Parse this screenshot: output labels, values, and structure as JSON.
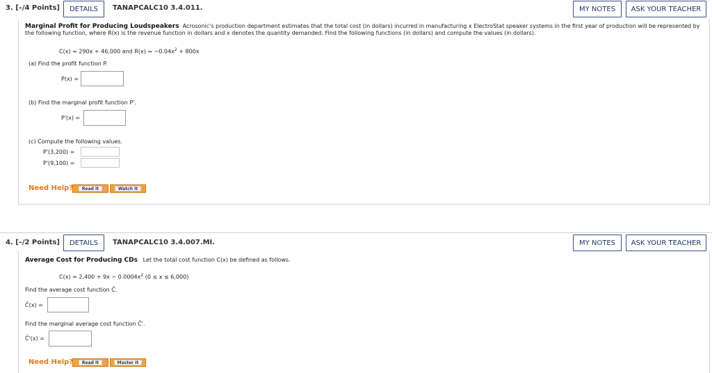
{
  "q1": {
    "number": "3.",
    "points": "[–/4 Points]",
    "details": "DETAILS",
    "code": "TANAPCALC10 3.4.011.",
    "my_notes": "MY NOTES",
    "ask_teacher": "ASK YOUR TEACHER",
    "title": "Marginal Profit for Producing Loudspeakers",
    "intro": "Acrosonic's production department estimates that the total cost (in dollars) incurred in manufacturing x ElectroStat speaker systems in the first year of production will be represented by the following function, where R(x) is the revenue function in dollars and x denotes the quantity demanded. Find the following functions (in dollars) and compute the values (in dollars).",
    "equation": "C(x) = 290x + 46,000   and   R(x) = −0.04x",
    "equation_exp": "2",
    "equation_tail": " + 800x",
    "part_a": "(a)   Find the profit function P.",
    "part_a_label": "P(x) =",
    "part_b": "(b)   Find the marginal profit function P'.",
    "part_b_label": "P'(x) =",
    "part_c": "(c)   Compute the following values.",
    "part_c_label1": "P'(3,200)  =",
    "part_c_label2": "P'(9,100)  =",
    "need_help": "Need Help?",
    "help_btn1": "Read It",
    "help_btn2": "Watch It"
  },
  "q2": {
    "number": "4.",
    "points": "[–/2 Points]",
    "details": "DETAILS",
    "code": "TANAPCALC10 3.4.007.MI.",
    "my_notes": "MY NOTES",
    "ask_teacher": "ASK YOUR TEACHER",
    "title": "Average Cost for Producing CDs",
    "intro": "Let the total cost function C(x) be defined as follows.",
    "equation": "C(x) = 2,400 + 9x − 0.0004x",
    "equation_exp": "2",
    "equation_tail": "    (0 ≤ x ≤ 6,000)",
    "avg_prompt": "Find the average cost function C̄.",
    "avg_label": "C̄(x) =",
    "marg_prompt": "Find the marginal average cost function C̄'.",
    "marg_label": "C̄'(x) =",
    "need_help": "Need Help?",
    "help_btn1": "Read It",
    "help_btn2": "Master It"
  },
  "colors": {
    "button_border": "#3b4f80",
    "need_help": "#e07b1b",
    "help_button": "#f4a23c"
  }
}
